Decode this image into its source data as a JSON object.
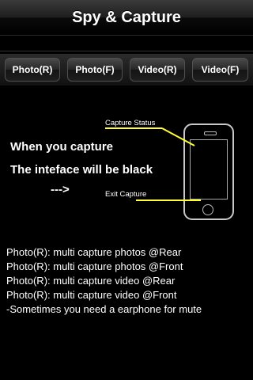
{
  "navbar": {
    "title": "Spy & Capture"
  },
  "toolbar": {
    "buttons": [
      {
        "label": "Photo(R)"
      },
      {
        "label": "Photo(F)"
      },
      {
        "label": "Video(R)"
      },
      {
        "label": "Video(F)"
      }
    ]
  },
  "instructions": {
    "line1": "When you capture",
    "line2": "The inteface will be black",
    "arrow": "--->"
  },
  "callouts": {
    "capture_status": "Capture Status",
    "exit_capture": "Exit Capture",
    "line_color": "#ffff33"
  },
  "description": {
    "lines": [
      "Photo(R): multi capture photos @Rear",
      "Photo(R): multi capture photos @Front",
      "Photo(R): multi capture video @Rear",
      "Photo(R): multi capture video @Front",
      "-Sometimes you need a earphone for mute"
    ]
  }
}
